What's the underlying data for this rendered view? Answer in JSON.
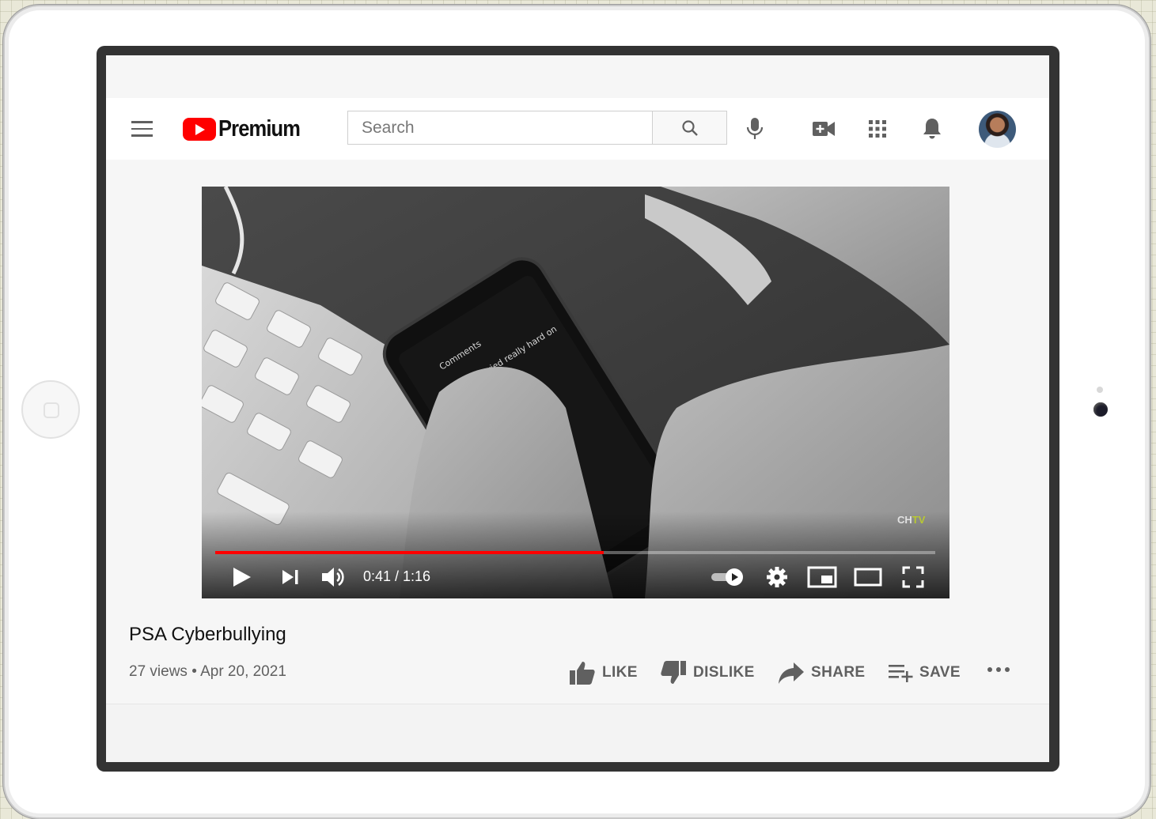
{
  "header": {
    "brand": "Premium",
    "search_placeholder": "Search"
  },
  "player": {
    "time": "0:41 / 1:16",
    "watermark_a": "CH",
    "watermark_b": "TV",
    "progress": 0.54,
    "accent_color": "#ff0000"
  },
  "video": {
    "title": "PSA Cyberbullying",
    "meta": "27 views • Apr 20, 2021"
  },
  "actions": {
    "like": "LIKE",
    "dislike": "DISLIKE",
    "share": "SHARE",
    "save": "SAVE"
  },
  "icons": [
    "menu-icon",
    "search-icon",
    "mic-icon",
    "create-video-icon",
    "apps-icon",
    "notifications-icon",
    "play-icon",
    "next-icon",
    "volume-icon",
    "autoplay-toggle-icon",
    "settings-icon",
    "miniplayer-icon",
    "theater-icon",
    "fullscreen-icon",
    "thumb-up-icon",
    "thumb-down-icon",
    "share-icon",
    "save-playlist-icon",
    "more-icon"
  ]
}
